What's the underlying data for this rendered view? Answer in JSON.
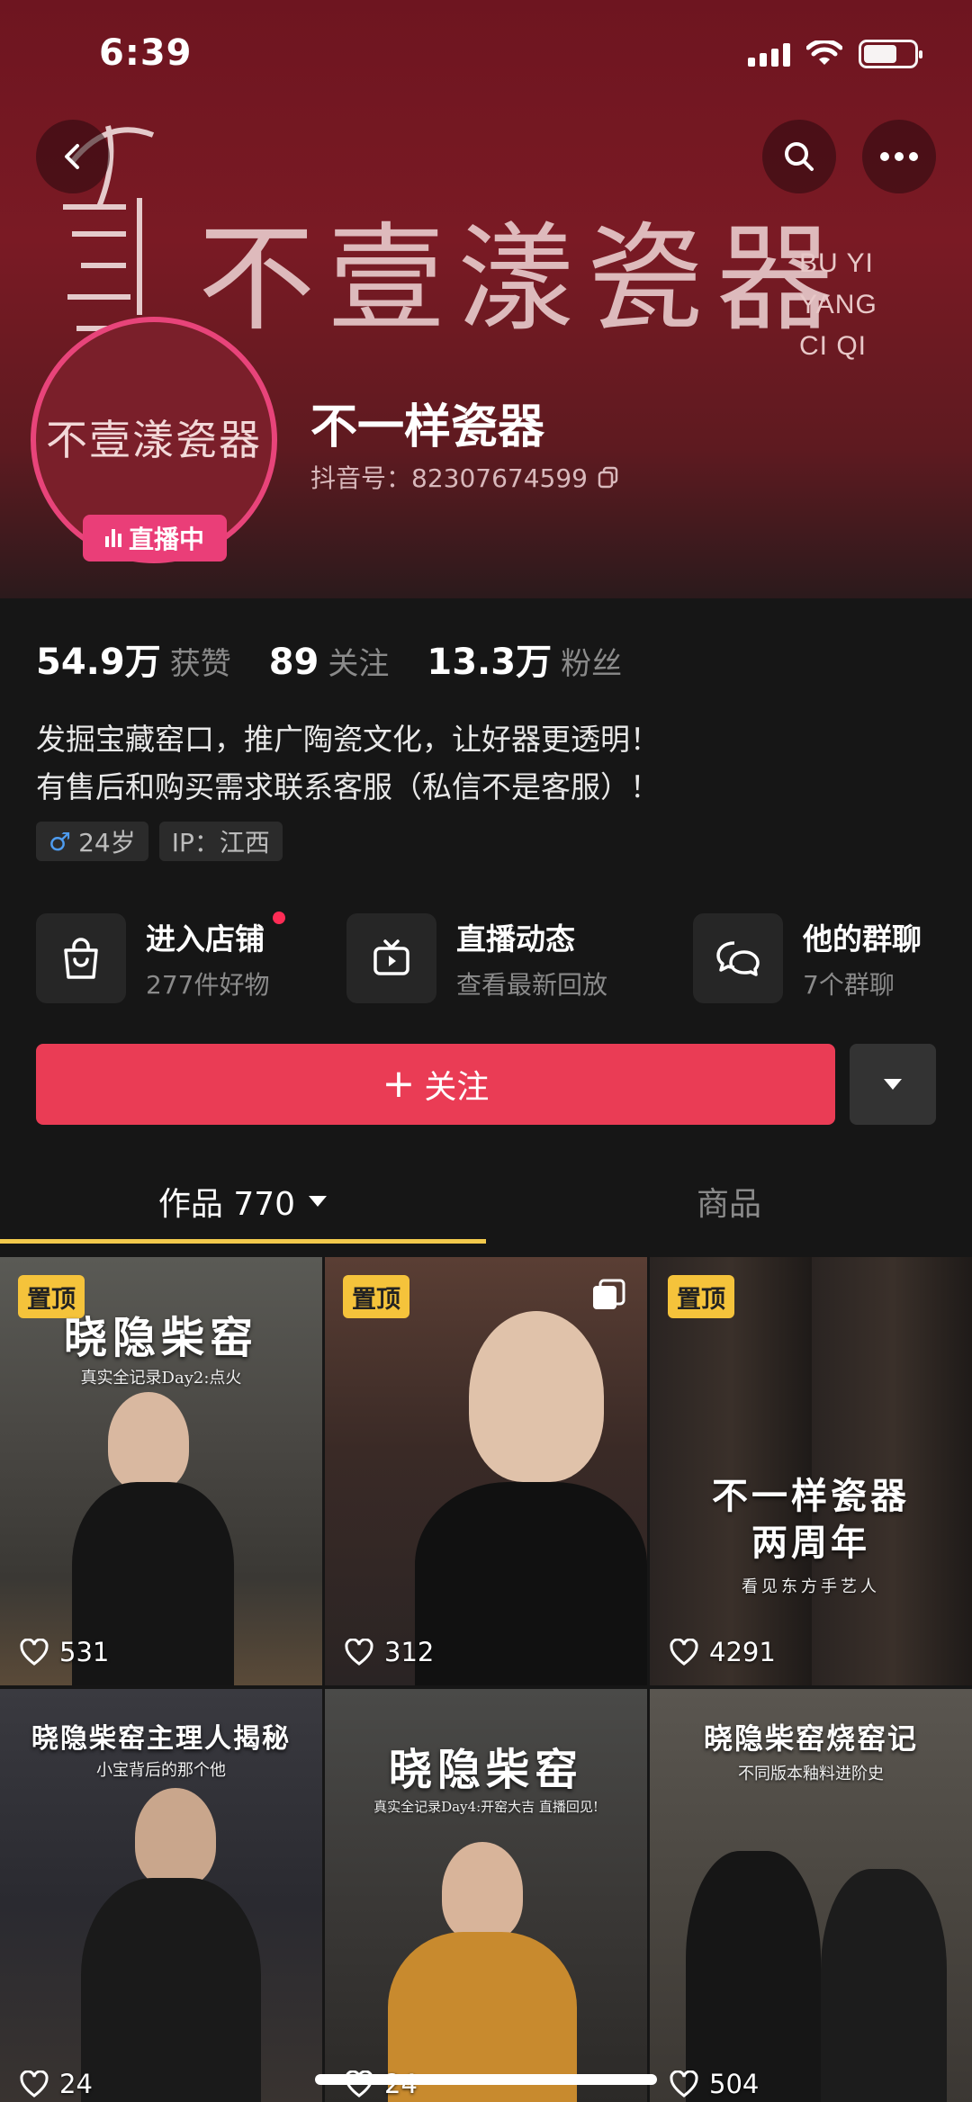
{
  "status_bar": {
    "time": "6:39"
  },
  "header": {
    "brand_title": "不壹漾瓷器",
    "brand_sub": [
      "BU YI",
      "YANG",
      "CI QI"
    ],
    "avatar_text": "不壹漾瓷器",
    "live_badge": "直播中",
    "name": "不一样瓷器",
    "douyin_id": "抖音号：82307674599"
  },
  "stats": [
    {
      "value": "54.9万",
      "label": "获赞"
    },
    {
      "value": "89",
      "label": "关注"
    },
    {
      "value": "13.3万",
      "label": "粉丝"
    }
  ],
  "bio": [
    "发掘宝藏窑口，推广陶瓷文化，让好器更透明！",
    "有售后和购买需求联系客服（私信不是客服）！"
  ],
  "tags": {
    "age": "24岁",
    "ip": "IP：江西"
  },
  "shortcuts": [
    {
      "title": "进入店铺",
      "sub": "277件好物",
      "icon": "shopping-bag-icon"
    },
    {
      "title": "直播动态",
      "sub": "查看最新回放",
      "icon": "tv-icon"
    },
    {
      "title": "他的群聊",
      "sub": "7个群聊",
      "icon": "chat-bubbles-icon"
    }
  ],
  "follow_label": "关注",
  "tabs": {
    "works": "作品 770",
    "goods": "商品"
  },
  "videos": [
    {
      "pinned": "置顶",
      "title": "晓隐柴窑",
      "subtitle": "真实全记录Day2:点火",
      "likes": "531"
    },
    {
      "pinned": "置顶",
      "title": "",
      "subtitle": "",
      "likes": "312",
      "multi": true
    },
    {
      "pinned": "置顶",
      "title": "不一样瓷器\n两周年",
      "subtitle": "看见东方手艺人",
      "likes": "4291"
    },
    {
      "pinned": "",
      "title": "晓隐柴窑主理人揭秘",
      "subtitle": "小宝背后的那个他",
      "likes": "24"
    },
    {
      "pinned": "",
      "title": "晓隐柴窑",
      "subtitle": "真实全记录Day4:开窑大吉 直播回见!",
      "likes": "24"
    },
    {
      "pinned": "",
      "title": "晓隐柴窑烧窑记",
      "subtitle": "不同版本釉料进阶史",
      "likes": "504"
    }
  ],
  "colors": {
    "accent": "#ea3c55",
    "live": "#ea3e78",
    "pin": "#f5c33b",
    "tab_underline": "#f2c94c"
  }
}
